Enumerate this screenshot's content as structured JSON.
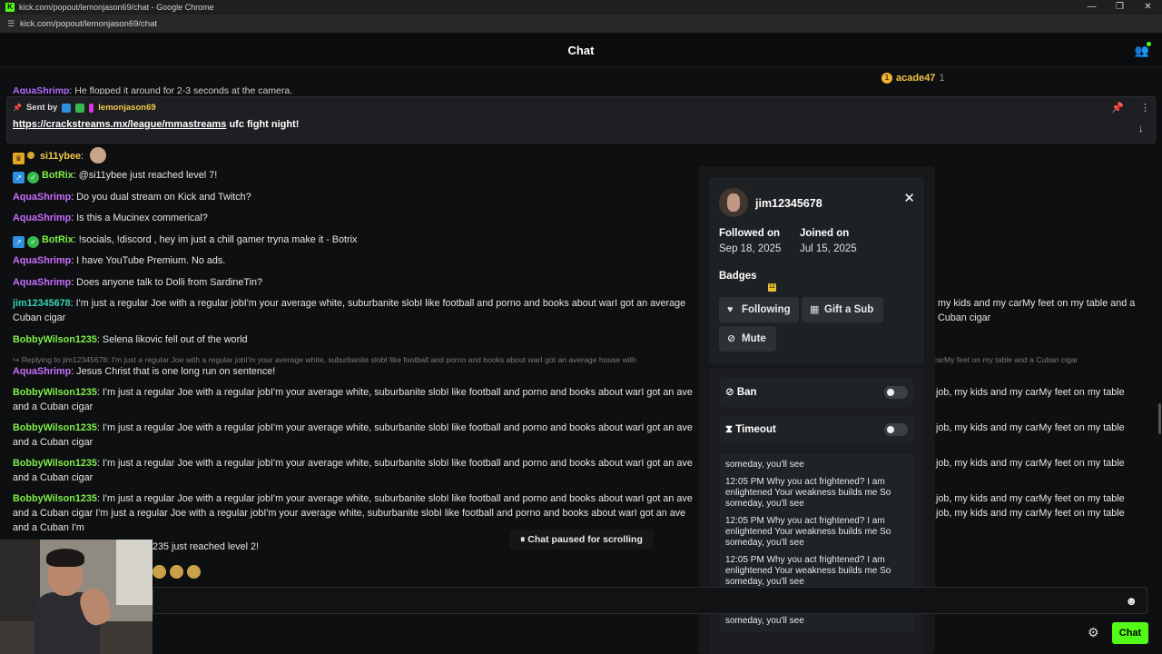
{
  "window": {
    "title": "kick.com/popout/lemonjason69/chat - Google Chrome",
    "url": "kick.com/popout/lemonjason69/chat",
    "logo": "K",
    "controls": [
      "—",
      "❐",
      "✕"
    ]
  },
  "header": {
    "title": "Chat",
    "users_icon": "👥"
  },
  "leaderboard": {
    "user": "acade47",
    "count": "1",
    "rank": "1"
  },
  "cut_message": {
    "user": "AquaShrimp",
    "text": ": He flopped it around for 2-3 seconds at the camera."
  },
  "pinned": {
    "sent_by": "Sent by",
    "user": "lemonjason69",
    "link": "https://crackstreams.mx/league/mmastreams",
    "text": " ufc fight night!",
    "pin_icon": "📌",
    "more_icon": "⋮",
    "arrow_icon": "↓"
  },
  "messages": [
    {
      "user": "si11ybee",
      "text": ":",
      "color": "yellow"
    },
    {
      "user": "BotRix",
      "text": ": @si11ybee just reached level 7!",
      "color": "green"
    },
    {
      "user": "AquaShrimp",
      "text": ": Do you dual stream on Kick and Twitch?",
      "color": "purple"
    },
    {
      "user": "AquaShrimp",
      "text": ": Is this a Mucinex commerical?",
      "color": "purple"
    },
    {
      "user": "BotRix",
      "text": ": !socials, !discord , hey im just a chill gamer tryna make it - Botrix",
      "color": "green"
    },
    {
      "user": "AquaShrimp",
      "text": ": I have YouTube Premium. No ads.",
      "color": "purple"
    },
    {
      "user": "AquaShrimp",
      "text": ": Does anyone talk to Dolli from SardineTin?",
      "color": "purple"
    },
    {
      "user": "jim12345678",
      "text": ": I'm just a regular Joe with a regular jobI'm your average white, suburbanite slobI like football and porno and books about warI got an average",
      "text_tail": "my kids and my carMy feet on my table and a Cuban cigar",
      "color": "teal"
    },
    {
      "user": "BobbyWilson1235",
      "text": ": Selena likovic fell out of the world",
      "color": "green"
    },
    {
      "reply": "Replying to jim12345678: I'm just a regular Joe with a regular jobI'm your average white, suburbanite slobI like football and porno and books about warI got an average house with",
      "reply_tail": "carMy feet on my table and a Cuban cigar"
    },
    {
      "user": "AquaShrimp",
      "text": ": Jesus Christ that is one long run on sentence!",
      "color": "purple"
    },
    {
      "user": "BobbyWilson1235",
      "text": ": I'm just a regular Joe with a regular jobI'm your average white, suburbanite slobI like football and porno and books about warI got an ave",
      "text_tail": "job, my kids and my carMy feet on my table",
      "line2": "and a Cuban cigar",
      "color": "green"
    },
    {
      "user": "BobbyWilson1235",
      "text": ": I'm just a regular Joe with a regular jobI'm your average white, suburbanite slobI like football and porno and books about warI got an ave",
      "text_tail": "job, my kids and my carMy feet on my table",
      "line2": "and a Cuban cigar",
      "color": "green"
    },
    {
      "user": "BobbyWilson1235",
      "text": ": I'm just a regular Joe with a regular jobI'm your average white, suburbanite slobI like football and porno and books about warI got an ave",
      "text_tail": "job, my kids and my carMy feet on my table",
      "line2": "and a Cuban cigar",
      "color": "green"
    },
    {
      "user": "BobbyWilson1235",
      "text": ": I'm just a regular Joe with a regular jobI'm your average white, suburbanite slobI like football and porno and books about warI got an ave",
      "text_tail": "job, my kids and my carMy feet on my table",
      "line2": "and a Cuban cigar I'm just a regular Joe with a regular jobI'm your average white, suburbanite slobI like football and porno and books about warI got an ave",
      "line2_tail": "job, my kids and my carMy feet on my table",
      "line3": "and a Cuban I'm",
      "color": "green"
    }
  ],
  "level_msg": "235 just reached level 2!",
  "paused": {
    "icon": "⏸",
    "label": "Chat paused for scrolling"
  },
  "user_card": {
    "username": "jim12345678",
    "close_icon": "✕",
    "followed_label": "Followed on",
    "followed_value": "Sep 18, 2025",
    "joined_label": "Joined on",
    "joined_value": "Jul 15, 2025",
    "badges_label": "Badges",
    "badge_glyph": "12",
    "following_button": "Following",
    "gift_button": "Gift a Sub",
    "mute_button": "Mute"
  },
  "moderation": {
    "ban_label": "Ban",
    "timeout_label": "Timeout",
    "history": [
      "someday, you'll see",
      "12:05 PM Why you act frightened? I am enlightened Your weakness builds me So someday, you'll see",
      "12:05 PM Why you act frightened? I am enlightened Your weakness builds me So someday, you'll see",
      "12:05 PM Why you act frightened? I am enlightened Your weakness builds me So someday, you'll see",
      "12:07 PM Why you act frightened? I am enlightened Your weakness builds me So someday, you'll see"
    ]
  },
  "input": {
    "placeholder": "",
    "value": ""
  },
  "footer": {
    "chat_button": "Chat",
    "gear_icon": "⚙",
    "smile_icon": "☻"
  },
  "colors": {
    "accent": "#53fc18",
    "panel": "#16181a"
  }
}
